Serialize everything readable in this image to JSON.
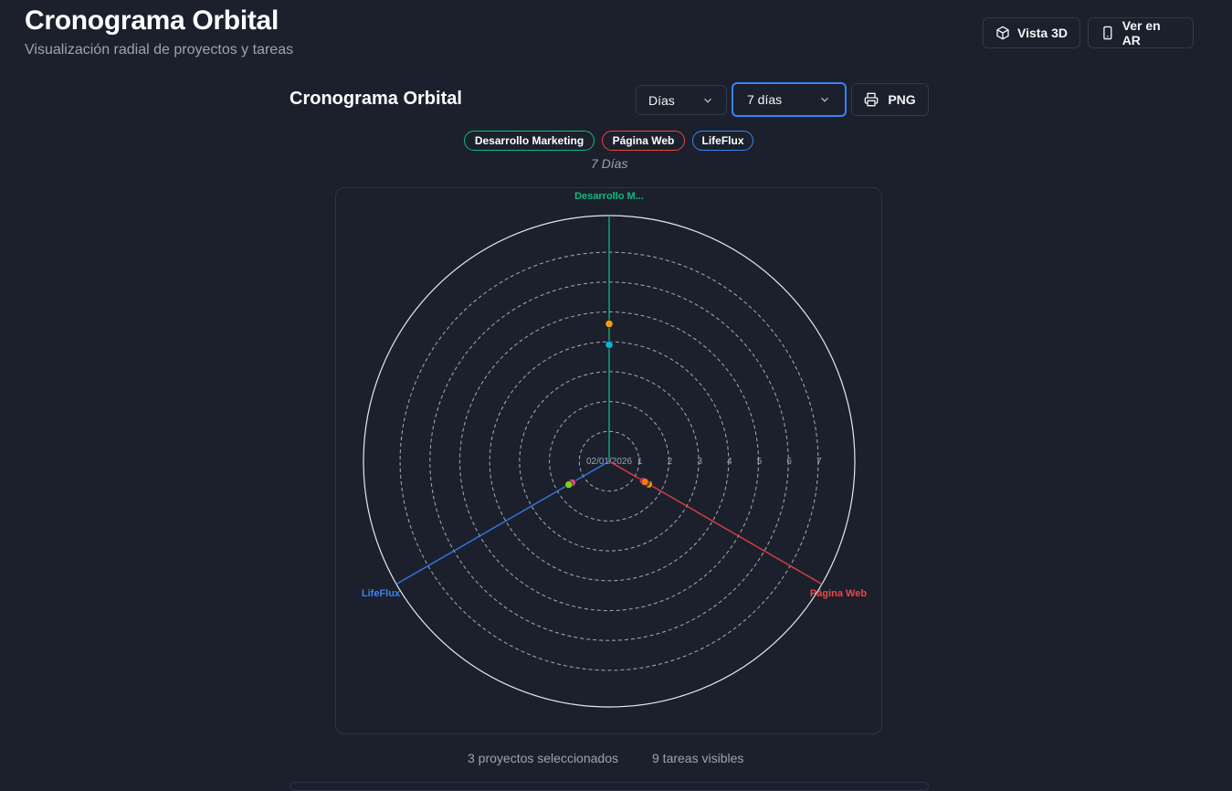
{
  "header": {
    "title": "Cronograma Orbital",
    "subtitle": "Visualización radial de proyectos y tareas",
    "btn_3d": "Vista 3D",
    "btn_ar": "Ver en AR"
  },
  "card": {
    "title": "Cronograma Orbital",
    "unit_select": "Días",
    "range_select": "7 días",
    "png_label": "PNG",
    "scale_label": "7 Días"
  },
  "projects": [
    {
      "name": "Desarrollo Marketing",
      "color": "#10b981"
    },
    {
      "name": "Página Web",
      "color": "#ef4444"
    },
    {
      "name": "LifeFlux",
      "color": "#3b82f6"
    }
  ],
  "chart_data": {
    "type": "scatter",
    "center_label": "02/01/2026",
    "rings": [
      "1",
      "2",
      "3",
      "4",
      "5",
      "6",
      "7"
    ],
    "max_days": 7,
    "axes": [
      {
        "label": "Desarrollo M...",
        "project": "Desarrollo Marketing",
        "angle_deg": 90,
        "color": "#10b981"
      },
      {
        "label": "Página Web",
        "project": "Página Web",
        "angle_deg": -30,
        "color": "#ef4444"
      },
      {
        "label": "LifeFlux",
        "project": "LifeFlux",
        "angle_deg": 210,
        "color": "#3b82f6"
      }
    ],
    "points": [
      {
        "project": "Desarrollo Marketing",
        "day": 4.6,
        "color": "#f59e0b"
      },
      {
        "project": "Desarrollo Marketing",
        "day": 3.9,
        "color": "#06b6d4"
      },
      {
        "project": "Página Web",
        "day": 1.53,
        "color": "#f59e0b"
      },
      {
        "project": "Página Web",
        "day": 1.42,
        "color": "#eab308"
      },
      {
        "project": "Página Web",
        "day": 1.32,
        "color": "#ec4899"
      },
      {
        "project": "Página Web",
        "day": 1.38,
        "color": "#f97316"
      },
      {
        "project": "LifeFlux",
        "day": 1.5,
        "color": "#8b5cf6"
      },
      {
        "project": "LifeFlux",
        "day": 1.44,
        "color": "#ec4899"
      },
      {
        "project": "LifeFlux",
        "day": 1.56,
        "color": "#84cc16"
      }
    ]
  },
  "footer": {
    "projects_selected": "3 proyectos seleccionados",
    "tasks_visible": "9 tareas visibles"
  }
}
